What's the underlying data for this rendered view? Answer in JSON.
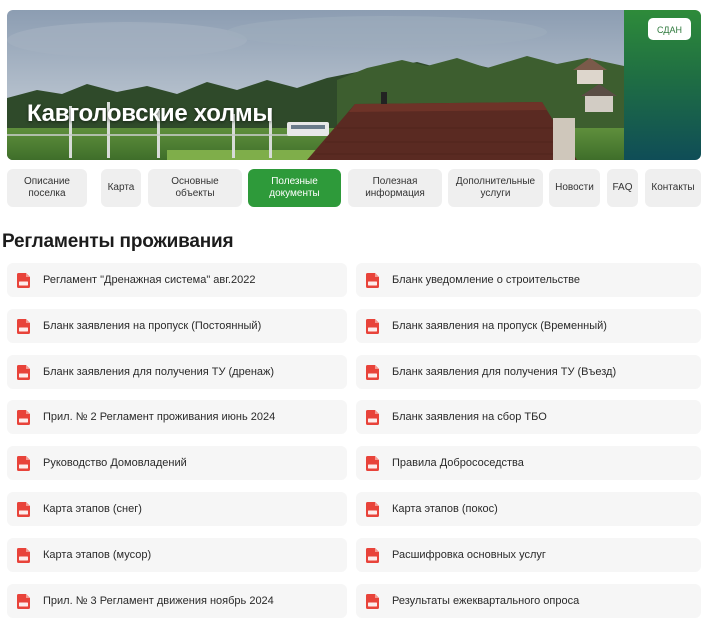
{
  "hero": {
    "title": "Кавголовские холмы",
    "status_button": "СДАН"
  },
  "nav": {
    "active_index": 3,
    "items": [
      "Описание поселка",
      "Карта",
      "Основные объекты",
      "Полезные документы",
      "Полезная информация",
      "Дополнительные услуги",
      "Новости",
      "FAQ",
      "Контакты"
    ]
  },
  "section": {
    "title": "Регламенты проживания"
  },
  "documents": {
    "icon": "pdf-file-icon",
    "left": [
      "Регламент \"Дренажная система\" авг.2022",
      "Бланк заявления на пропуск (Постоянный)",
      "Бланк заявления для получения ТУ (дренаж)",
      "Прил. № 2 Регламент проживания июнь 2024",
      "Руководство Домовладений",
      "Карта этапов (снег)",
      "Карта этапов (мусор)",
      "Прил. № 3 Регламент движения ноябрь 2024"
    ],
    "right": [
      "Бланк уведомление о строительстве",
      "Бланк заявления на пропуск (Временный)",
      "Бланк заявления для получения ТУ (Въезд)",
      "Бланк заявления на сбор ТБО",
      "Правила Добрососедства",
      "Карта этапов (покос)",
      "Расшифровка основных услуг",
      "Результаты ежеквартального опроса"
    ]
  },
  "colors": {
    "accent": "#2e9a3a",
    "pdf_red": "#e8433a",
    "item_bg": "#f6f6f6",
    "nav_bg": "#efefef"
  }
}
